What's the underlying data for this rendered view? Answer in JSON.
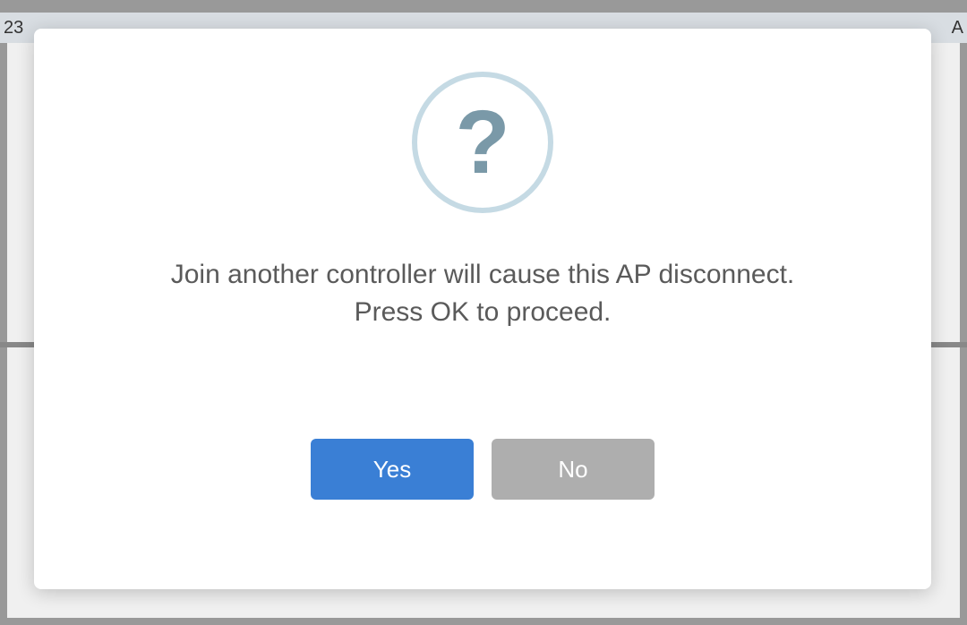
{
  "background": {
    "left_text": "23",
    "right_text": "A"
  },
  "dialog": {
    "icon": "question-mark-icon",
    "icon_glyph": "?",
    "message": "Join another controller will cause this AP disconnect.\nPress OK to proceed.",
    "buttons": {
      "confirm_label": "Yes",
      "cancel_label": "No"
    },
    "colors": {
      "confirm_bg": "#3a7fd5",
      "cancel_bg": "#aeaeae",
      "icon_ring": "#c5dae4",
      "icon_color": "#7a99a8"
    }
  }
}
